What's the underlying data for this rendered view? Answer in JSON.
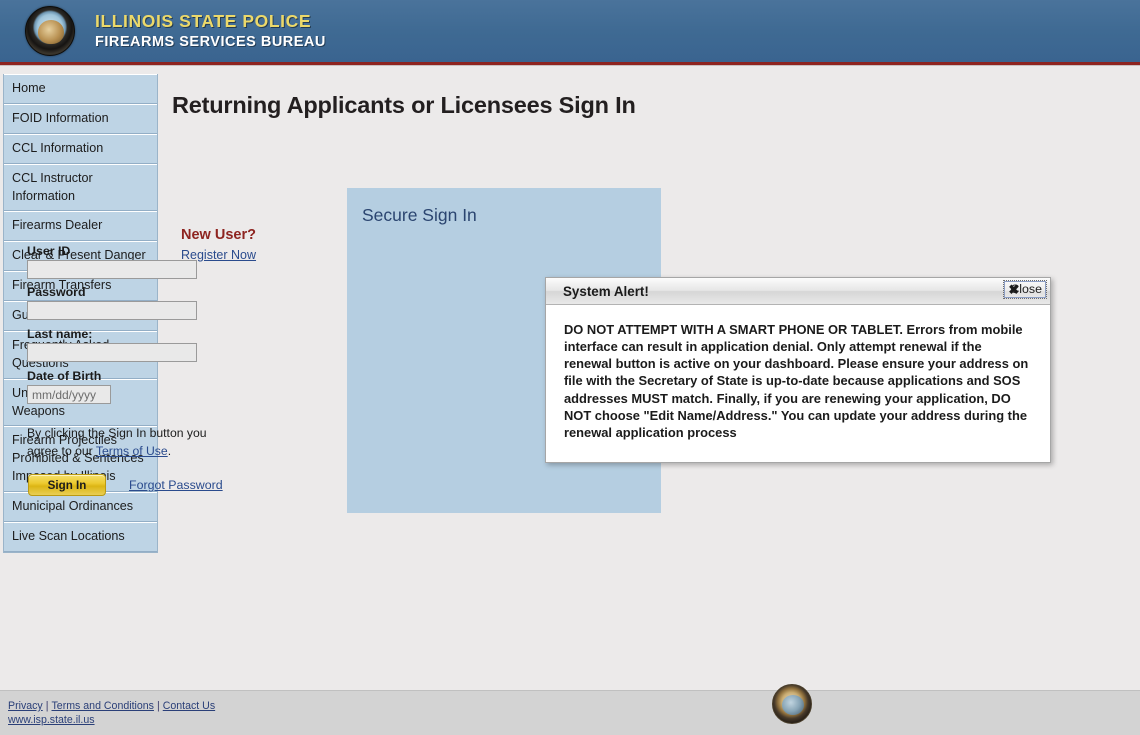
{
  "header": {
    "seal_icon": "illinois-state-police-seal-icon",
    "title_main": "ILLINOIS STATE POLICE",
    "title_sub": "FIREARMS SERVICES BUREAU",
    "accent_color": "#8e2420",
    "background_color": "#3f6a93",
    "title_main_color": "#ecd96a"
  },
  "sidebar": {
    "items": [
      {
        "label": "Home"
      },
      {
        "label": "FOID Information"
      },
      {
        "label": "CCL Information"
      },
      {
        "label": "CCL Instructor Information"
      },
      {
        "label": "Firearms Dealer"
      },
      {
        "label": "Clear & Present Danger"
      },
      {
        "label": "Firearm Transfers"
      },
      {
        "label": "Gun Show Information"
      },
      {
        "label": "Frequently Asked Questions"
      },
      {
        "label": "Unlawful Use of Weapons"
      },
      {
        "label": "Firearm Projectiles Prohibited & Sentences Imposed by Illinois"
      },
      {
        "label": "Municipal Ordinances"
      },
      {
        "label": "Live Scan Locations"
      }
    ],
    "background_color": "#bed4e5"
  },
  "main": {
    "page_title": "Returning Applicants or Licensees Sign In",
    "new_user": {
      "heading": "New User?",
      "register_link": "Register Now",
      "heading_color": "#8e2420"
    },
    "signin_panel": {
      "heading": "Secure Sign In",
      "background_color": "#b5cee1",
      "fields": [
        {
          "label": "User ID",
          "value": "",
          "placeholder": ""
        },
        {
          "label": "Password",
          "value": "",
          "placeholder": ""
        },
        {
          "label": "Last name:",
          "value": "",
          "placeholder": ""
        },
        {
          "label": "Date of Birth",
          "value": "",
          "placeholder": "mm/dd/yyyy"
        }
      ],
      "terms_prefix": "By clicking the Sign In button you agree to our ",
      "terms_link": "Terms of Use",
      "terms_suffix": ".",
      "signin_button": "Sign In",
      "signin_button_color": "#ecc92f",
      "forgot_password_link": "Forgot Password"
    }
  },
  "system_alert": {
    "title": "System Alert!",
    "close_icon": "close-x-icon",
    "close_label": "Close",
    "message": "DO NOT ATTEMPT WITH A SMART PHONE OR TABLET. Errors from mobile interface can result in application denial. Only attempt renewal if the renewal button is active on your dashboard. Please ensure your address on file with the Secretary of State is up-to-date because applications and SOS addresses MUST match. Finally, if you are renewing your application, DO NOT choose \"Edit Name/Address.\" You can update your address during the renewal application process"
  },
  "footer": {
    "links": [
      {
        "label": "Privacy"
      },
      {
        "label": "Terms and Conditions"
      },
      {
        "label": "Contact Us"
      }
    ],
    "separator": "|",
    "url": "www.isp.state.il.us",
    "seal_icon": "illinois-state-seal-icon"
  }
}
